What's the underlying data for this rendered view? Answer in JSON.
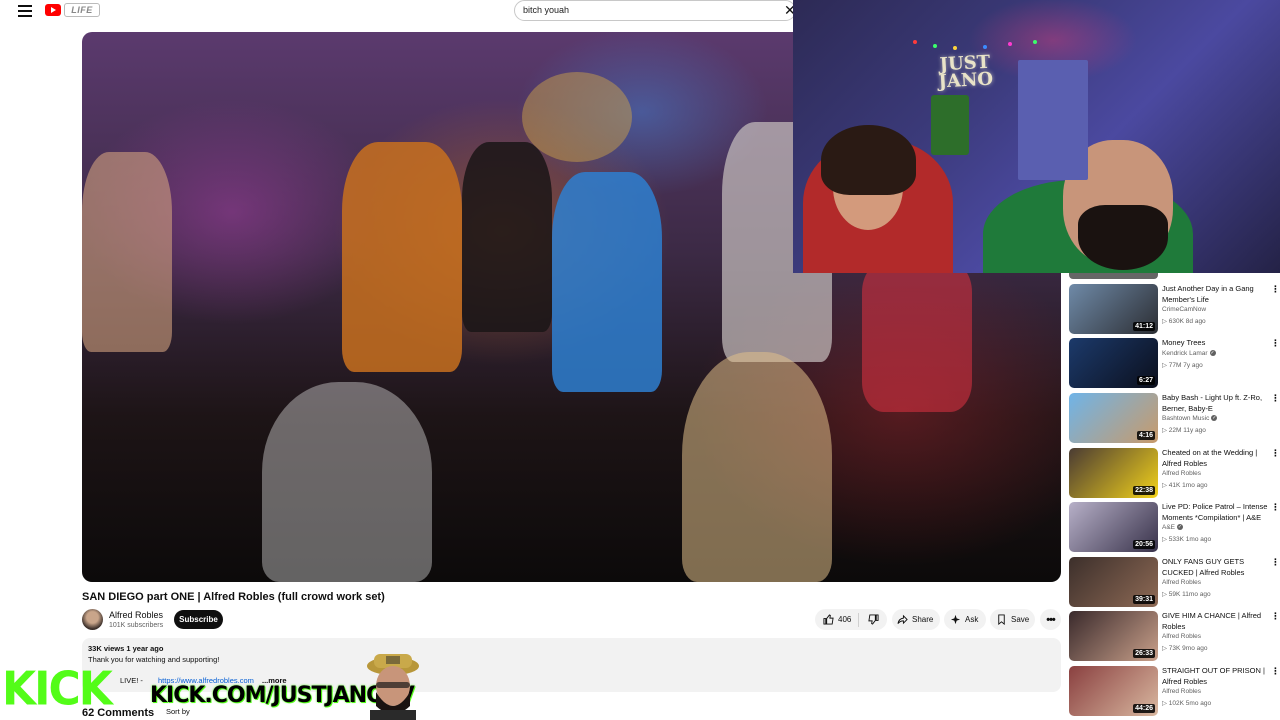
{
  "header": {
    "brand_text": "LIFE",
    "search_value": "bitch youah",
    "clear_glyph": "✕"
  },
  "webcam": {
    "sign_line1": "JUST",
    "sign_line2": "JANO"
  },
  "video": {
    "title": "SAN DIEGO part ONE | Alfred Robles (full crowd work set)",
    "channel_name": "Alfred Robles",
    "subscribers": "101K subscribers",
    "subscribe_label": "Subscribe",
    "like_count": "406",
    "share_label": "Share",
    "ask_label": "Ask",
    "save_label": "Save",
    "more_label": "•••"
  },
  "description": {
    "meta": "33K views  1 year ago",
    "text": "Thank you for watching and supporting!",
    "live_label": "LIVE! -",
    "link": "https://www.alfredrobles.com",
    "more": "...more"
  },
  "comments": {
    "count_label": "62 Comments",
    "sort_label": "Sort by"
  },
  "overlay": {
    "kick_logo": "KICK",
    "kick_url": "KICK.COM/JUSTJANOTV"
  },
  "recommendations": [
    {
      "title": "Just Another Day in a Gang Member's Life",
      "channel": "CrimeCamNow",
      "meta": "▷ 630K  8d ago",
      "duration": "41:12",
      "verified": false,
      "colors": [
        "#6f8aa8",
        "#2c2e33"
      ]
    },
    {
      "title": "Money Trees",
      "channel": "Kendrick Lamar",
      "meta": "▷ 77M  7y ago",
      "duration": "6:27",
      "verified": true,
      "colors": [
        "#1c3a6b",
        "#0b0f1c"
      ]
    },
    {
      "title": "Baby Bash - Light Up ft. Z-Ro, Berner, Baby-E",
      "channel": "Bashtown Music",
      "meta": "▷ 22M  11y ago",
      "duration": "4:16",
      "verified": true,
      "colors": [
        "#6fb4e8",
        "#c89a6a"
      ]
    },
    {
      "title": "Cheated on at the Wedding | Alfred Robles",
      "channel": "Alfred Robles",
      "meta": "▷ 41K  1mo ago",
      "duration": "22:38",
      "verified": false,
      "colors": [
        "#4a3b33",
        "#f2d21b"
      ]
    },
    {
      "title": "Live PD: Police Patrol – Intense Moments *Compilation* | A&E",
      "channel": "A&E",
      "meta": "▷ 533K  1mo ago",
      "duration": "20:56",
      "verified": true,
      "colors": [
        "#b7b0c8",
        "#38324a"
      ]
    },
    {
      "title": "ONLY FANS GUY GETS CUCKED | Alfred Robles",
      "channel": "Alfred Robles",
      "meta": "▷ 59K  11mo ago",
      "duration": "39:31",
      "verified": false,
      "colors": [
        "#3c2f2b",
        "#8e6a55"
      ]
    },
    {
      "title": "GIVE HIM A CHANCE | Alfred Robles",
      "channel": "Alfred Robles",
      "meta": "▷ 73K  9mo ago",
      "duration": "26:33",
      "verified": false,
      "colors": [
        "#3a2a2c",
        "#c9a08a"
      ]
    },
    {
      "title": "STRAIGHT OUT OF PRISON | Alfred Robles",
      "channel": "Alfred Robles",
      "meta": "▷ 102K  5mo ago",
      "duration": "44:26",
      "verified": false,
      "colors": [
        "#8a4040",
        "#d9b8a0"
      ]
    }
  ],
  "colors": {
    "kick_green": "#53fc18",
    "youtube_red": "#ff0000",
    "link_blue": "#065fd4"
  }
}
